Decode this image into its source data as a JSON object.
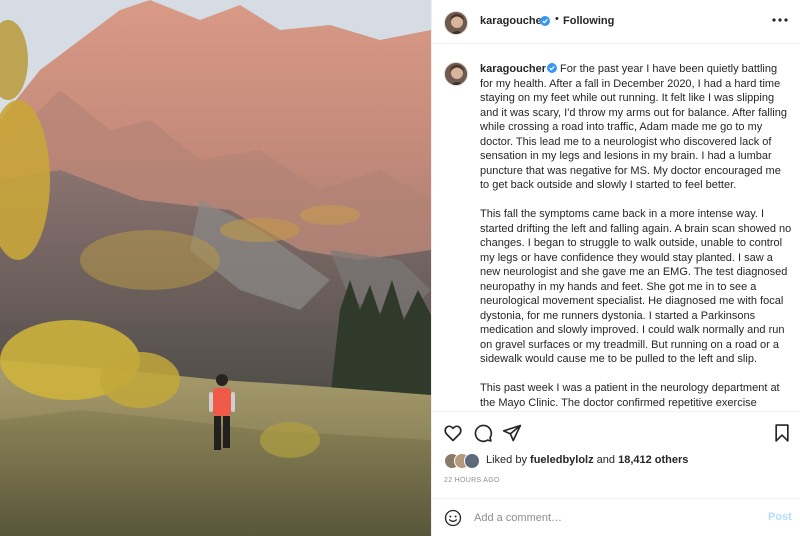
{
  "post": {
    "photo_alt": "Runner on mountain trail",
    "author": {
      "username": "karagoucher",
      "verified": true,
      "avatar": "avatar-image"
    },
    "header": {
      "separator": "•",
      "follow_status": "Following",
      "more_icon": "more-horizontal-icon"
    },
    "caption": {
      "username": "karagoucher",
      "paragraphs": [
        "For the past year I have been quietly battling for my health. After a fall in December 2020, I had a hard time staying on my feet while out running. It felt like I was slipping and it was scary, I'd throw my arms out for balance. After falling while crossing a road into traffic, Adam made me go to my doctor. This lead me to a neurologist who discovered lack of sensation in my legs and lesions in my brain. I had a lumbar puncture that was negative for MS. My doctor encouraged me to get back outside and slowly I started to feel better.",
        "This fall the symptoms came back in a more intense way. I started drifting the left and falling again. A brain scan showed no changes. I began to struggle to walk outside, unable to control my legs or have confidence they would stay planted. I saw a new neurologist and she gave me an EMG. The test diagnosed neuropathy in my hands and feet. She got me in to see a neurological movement specialist. He diagnosed me with focal dystonia, for me runners dystonia. I started a Parkinsons medication and slowly improved. I could walk normally and run on gravel surfaces or my treadmill. But running on a road or a sidewalk would cause me to be pulled to the left and slip.",
        "This past week I was a patient in the neurology department at the Mayo Clinic. The doctor confirmed repetitive exercise dystonia, and tried to tell me, as gently as possible, that the more I run the worse my symptoms will get. I have to drastically cut back or not only will"
      ]
    },
    "actions": {
      "like": "heart-icon",
      "comment": "comment-icon",
      "share": "send-icon",
      "save": "bookmark-icon"
    },
    "likes": {
      "prefix": "Liked by",
      "liked_by": "fueledbylolz",
      "and": "and",
      "count_text": "18,412 others"
    },
    "timestamp": "22 HOURS AGO",
    "comment_box": {
      "placeholder": "Add a comment…",
      "post_label": "Post",
      "emoji_icon": "emoji-smile-icon"
    }
  },
  "colors": {
    "verified_blue": "#3897f0",
    "post_disabled": "#b2dffc",
    "muted": "#8e8e8e",
    "border": "#efefef"
  }
}
